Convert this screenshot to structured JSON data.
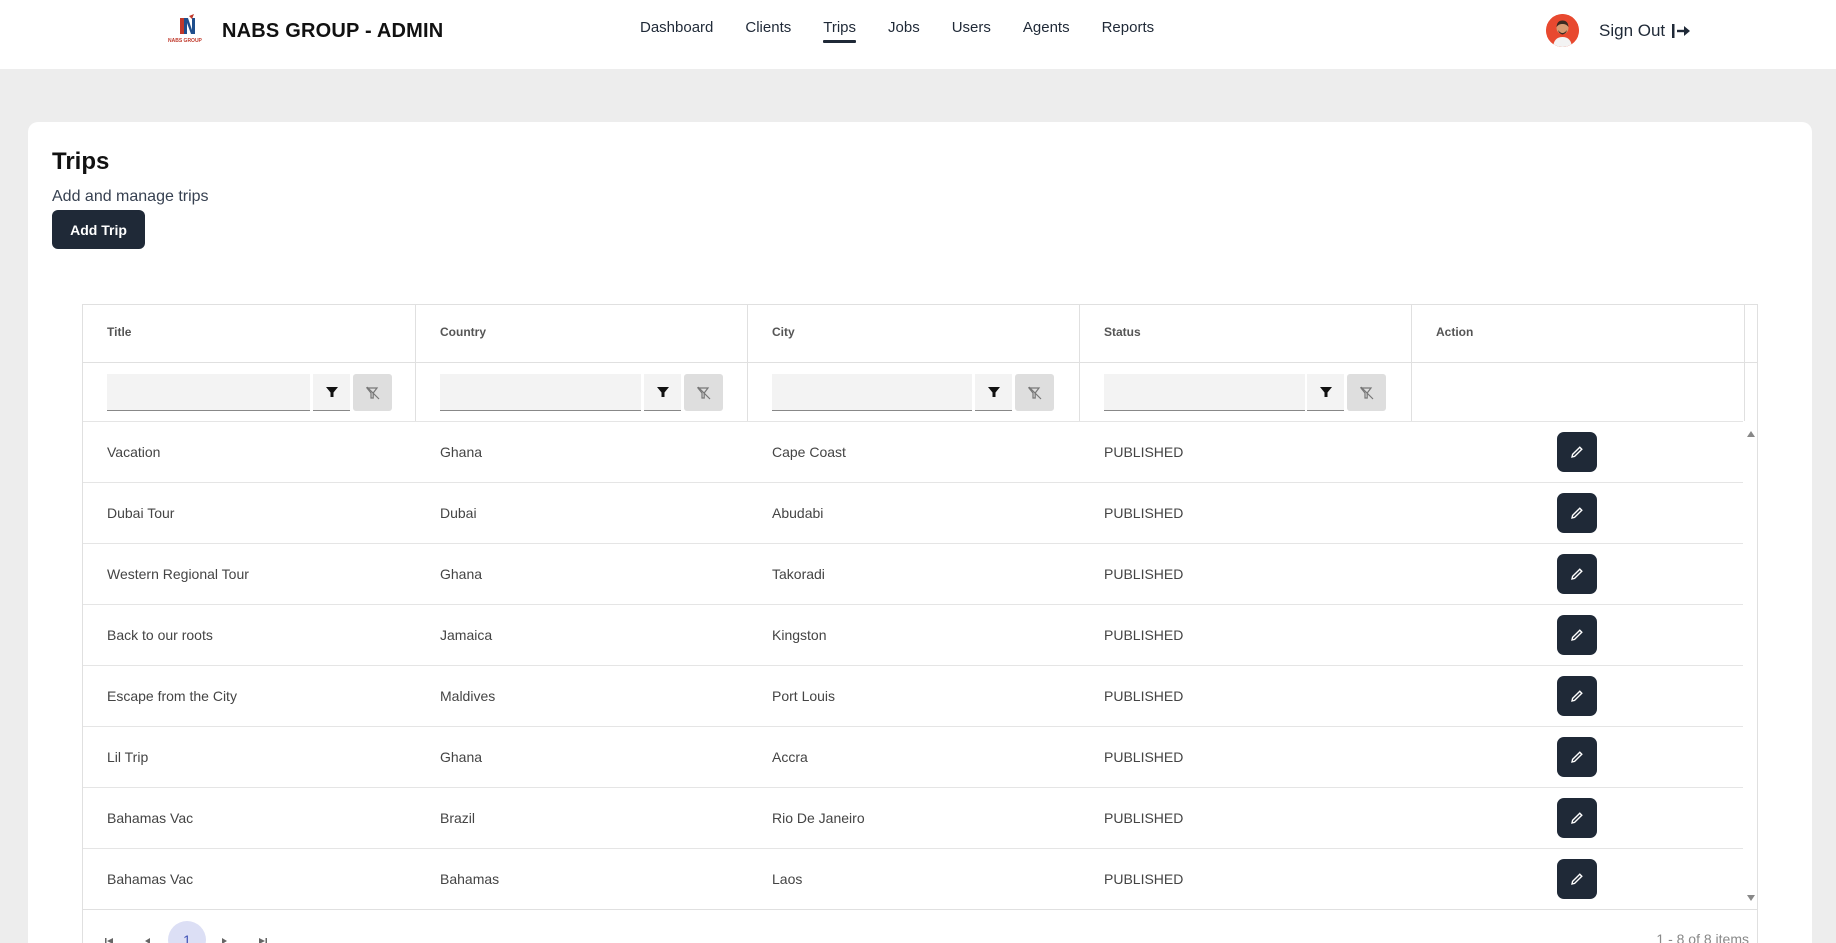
{
  "header": {
    "logo_text": "NABS GROUP",
    "brand_title": "NABS GROUP - ADMIN",
    "nav": [
      "Dashboard",
      "Clients",
      "Trips",
      "Jobs",
      "Users",
      "Agents",
      "Reports"
    ],
    "active_nav": "Trips",
    "signout_label": "Sign Out"
  },
  "page": {
    "title": "Trips",
    "subtitle": "Add and manage trips",
    "add_button": "Add Trip"
  },
  "table": {
    "columns": [
      "Title",
      "Country",
      "City",
      "Status",
      "Action"
    ],
    "rows": [
      {
        "title": "Vacation",
        "country": "Ghana",
        "city": "Cape Coast",
        "status": "PUBLISHED"
      },
      {
        "title": "Dubai Tour",
        "country": "Dubai",
        "city": "Abudabi",
        "status": "PUBLISHED"
      },
      {
        "title": "Western Regional Tour",
        "country": "Ghana",
        "city": "Takoradi",
        "status": "PUBLISHED"
      },
      {
        "title": "Back to our roots",
        "country": "Jamaica",
        "city": "Kingston",
        "status": "PUBLISHED"
      },
      {
        "title": "Escape from the City",
        "country": "Maldives",
        "city": "Port Louis",
        "status": "PUBLISHED"
      },
      {
        "title": "Lil Trip",
        "country": "Ghana",
        "city": "Accra",
        "status": "PUBLISHED"
      },
      {
        "title": "Bahamas Vac",
        "country": "Brazil",
        "city": "Rio De Janeiro",
        "status": "PUBLISHED"
      },
      {
        "title": "Bahamas Vac",
        "country": "Bahamas",
        "city": "Laos",
        "status": "PUBLISHED"
      }
    ]
  },
  "pager": {
    "current_page": "1",
    "info": "1 - 8 of 8 items"
  },
  "colors": {
    "primary": "#1f2937",
    "avatar_bg": "#e8492f",
    "pager_active_bg": "#dcdff5",
    "pager_active_text": "#3f51b5"
  }
}
